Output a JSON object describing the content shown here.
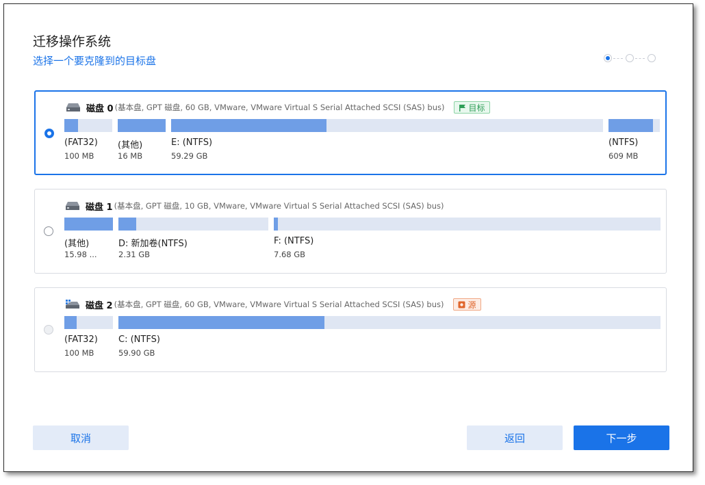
{
  "header": {
    "title": "迁移操作系统",
    "subtitle": "选择一个要克隆到的目标盘"
  },
  "stepper": {
    "total": 3,
    "current": 1
  },
  "colors": {
    "accent": "#1a73e8",
    "partition_fill": "#6f9ee6",
    "partition_track": "#dfe6f3"
  },
  "disks": [
    {
      "name": "磁盘 0",
      "description": "(基本盘, GPT 磁盘, 60 GB, VMware,  VMware Virtual S Serial Attached SCSI (SAS) bus)",
      "tag": "目标",
      "icon": "hard-drive-icon",
      "selected": true,
      "partitions": [
        {
          "label": "(FAT32)",
          "size": "100 MB",
          "used_fraction": 0.29
        },
        {
          "label": "(其他)",
          "size": "16 MB",
          "used_fraction": 1.0
        },
        {
          "label": "E: (NTFS)",
          "size": "59.29 GB",
          "used_fraction": 0.36
        },
        {
          "label": "(NTFS)",
          "size": "609 MB",
          "used_fraction": 0.87
        }
      ]
    },
    {
      "name": "磁盘 1",
      "description": "(基本盘, GPT 磁盘, 10 GB, VMware,  VMware Virtual S Serial Attached SCSI (SAS) bus)",
      "tag": "",
      "icon": "hard-drive-icon",
      "selected": false,
      "partitions": [
        {
          "label": "(其他)",
          "size": "15.98 ...",
          "used_fraction": 1.0
        },
        {
          "label": "D: 新加卷(NTFS)",
          "size": "2.31 GB",
          "used_fraction": 0.12
        },
        {
          "label": "F: (NTFS)",
          "size": "7.68 GB",
          "used_fraction": 0.01
        }
      ]
    },
    {
      "name": "磁盘 2",
      "description": "(基本盘, GPT 磁盘, 60 GB, VMware,  VMware Virtual S Serial Attached SCSI (SAS) bus)",
      "tag": "源",
      "icon": "system-disk-icon",
      "selected": false,
      "disabled": true,
      "partitions": [
        {
          "label": "(FAT32)",
          "size": "100 MB",
          "used_fraction": 0.26
        },
        {
          "label": "C: (NTFS)",
          "size": "59.90 GB",
          "used_fraction": 0.38
        }
      ]
    }
  ],
  "footer": {
    "cancel_label": "取消",
    "back_label": "返回",
    "next_label": "下一步"
  }
}
